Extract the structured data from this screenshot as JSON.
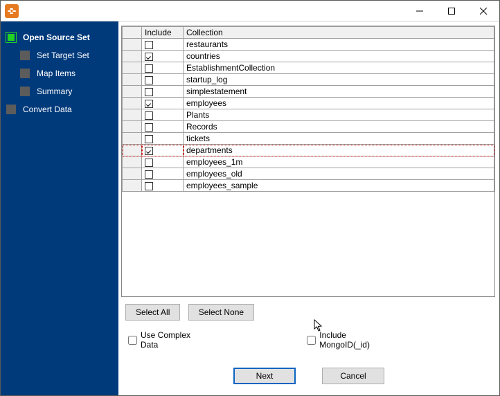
{
  "wizard": {
    "steps": {
      "open_source": "Open Source Set",
      "set_target": "Set Target Set",
      "map_items": "Map Items",
      "summary": "Summary",
      "convert": "Convert Data"
    }
  },
  "table": {
    "headers": {
      "include": "Include",
      "collection": "Collection"
    },
    "rows": [
      {
        "include": false,
        "name": "restaurants"
      },
      {
        "include": true,
        "name": "countries"
      },
      {
        "include": false,
        "name": "EstablishmentCollection"
      },
      {
        "include": false,
        "name": "startup_log"
      },
      {
        "include": false,
        "name": "simplestatement"
      },
      {
        "include": true,
        "name": "employees"
      },
      {
        "include": false,
        "name": "Plants"
      },
      {
        "include": false,
        "name": "Records"
      },
      {
        "include": false,
        "name": "tickets"
      },
      {
        "include": true,
        "name": "departments",
        "selected": true
      },
      {
        "include": false,
        "name": "employees_1m"
      },
      {
        "include": false,
        "name": "employees_old"
      },
      {
        "include": false,
        "name": "employees_sample"
      }
    ]
  },
  "buttons": {
    "select_all": "Select All",
    "select_none": "Select None",
    "next": "Next",
    "cancel": "Cancel"
  },
  "options": {
    "use_complex": {
      "label": "Use Complex Data",
      "checked": false
    },
    "include_mongoid": {
      "label": "Include MongoID(_id)",
      "checked": false
    }
  }
}
